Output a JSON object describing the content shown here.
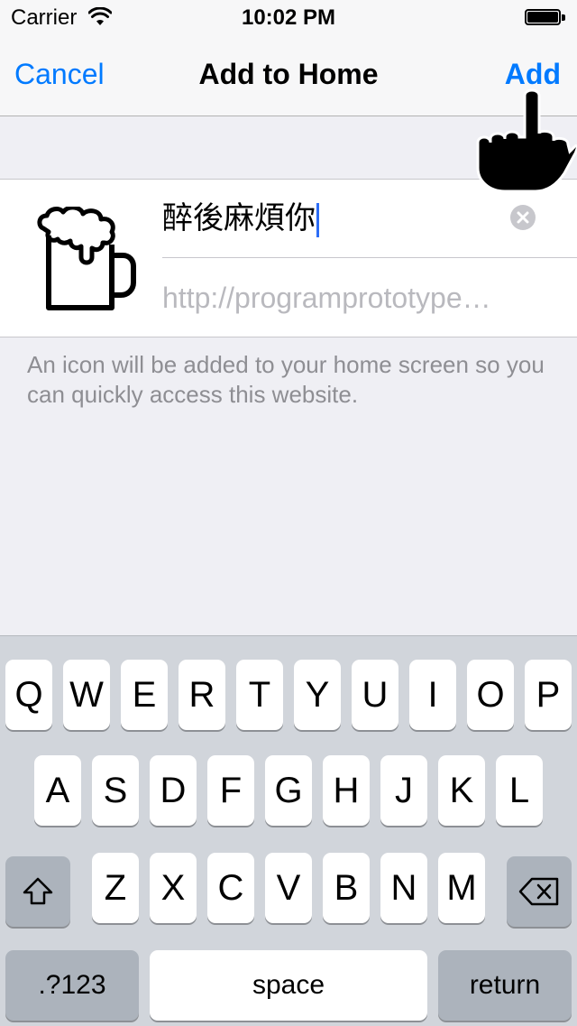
{
  "status_bar": {
    "carrier": "Carrier",
    "time": "10:02 PM"
  },
  "nav": {
    "cancel_label": "Cancel",
    "title": "Add to Home",
    "add_label": "Add"
  },
  "form": {
    "title_value": "醉後麻煩你",
    "url_value": "http://programprototype…"
  },
  "help_text": "An icon will be added to your home screen so you can quickly access this website.",
  "keyboard": {
    "row1": [
      "Q",
      "W",
      "E",
      "R",
      "T",
      "Y",
      "U",
      "I",
      "O",
      "P"
    ],
    "row2": [
      "A",
      "S",
      "D",
      "F",
      "G",
      "H",
      "J",
      "K",
      "L"
    ],
    "row3": [
      "Z",
      "X",
      "C",
      "V",
      "B",
      "N",
      "M"
    ],
    "numbers_label": ".?123",
    "space_label": "space",
    "return_label": "return"
  },
  "colors": {
    "accent": "#007aff",
    "caret": "#2d6df6",
    "keyboard_bg": "#d1d5db"
  },
  "icons": [
    "wifi-icon",
    "battery-icon",
    "hand-pointer-icon",
    "beer-mug-icon",
    "clear-icon",
    "shift-icon",
    "delete-icon"
  ]
}
